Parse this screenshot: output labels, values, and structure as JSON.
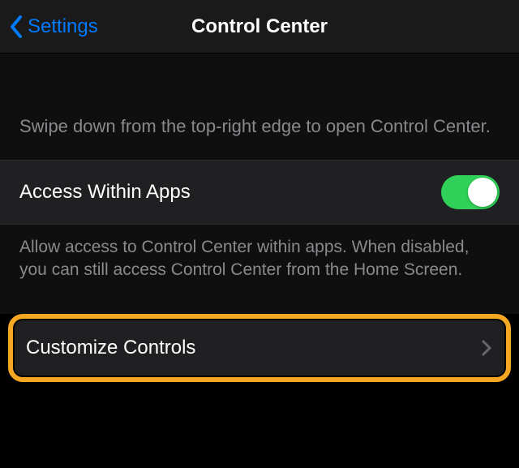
{
  "nav": {
    "back_label": "Settings",
    "title": "Control Center"
  },
  "intro_text": "Swipe down from the top-right edge to open Control Center.",
  "access_row": {
    "label": "Access Within Apps",
    "toggle_on": true
  },
  "access_footer": "Allow access to Control Center within apps. When disabled, you can still access Control Center from the Home Screen.",
  "customize_row": {
    "label": "Customize Controls"
  },
  "colors": {
    "accent_blue": "#007aff",
    "toggle_green": "#30d158",
    "highlight_orange": "#f5a623"
  }
}
